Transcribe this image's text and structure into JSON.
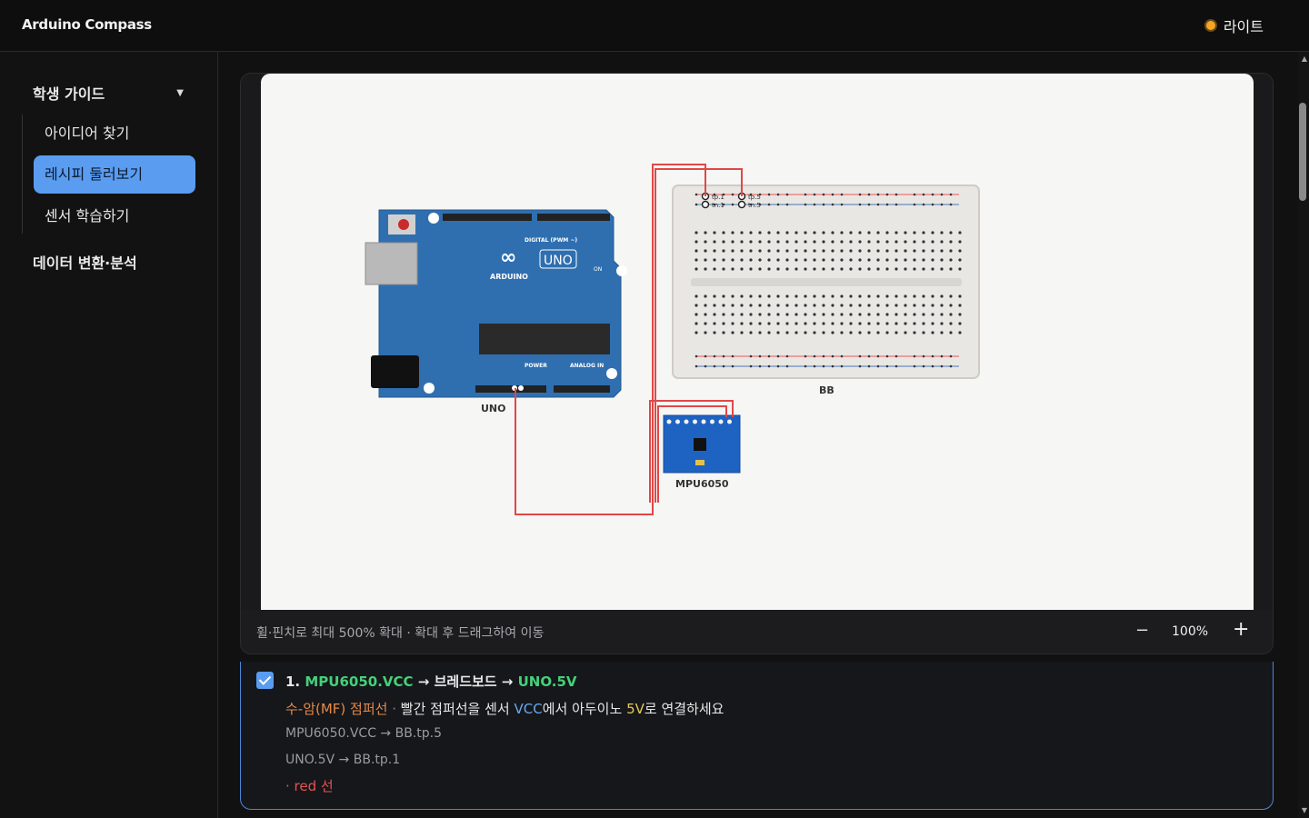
{
  "app": {
    "title": "Arduino Compass",
    "theme_label": "라이트",
    "theme_icon": "sun-icon"
  },
  "sidebar": {
    "group_label": "학생 가이드",
    "items": [
      {
        "label": "아이디어 찾기"
      },
      {
        "label": "레시피 둘러보기",
        "active": true
      },
      {
        "label": "센서 학습하기"
      }
    ],
    "data_label": "데이터 변환·분석"
  },
  "diagram": {
    "uno_label": "UNO",
    "bb_label": "BB",
    "mpu_label": "MPU6050",
    "board_text": "UNO",
    "board_brand": "ARDUINO",
    "digital_label": "DIGITAL (PWM ~)",
    "power_label": "POWER",
    "analog_label": "ANALOG IN",
    "on_label": "ON",
    "pin_labels": {
      "tp1": "tp.1",
      "tn1": "tn.1",
      "tp5": "tp.5",
      "tn5": "tn.5"
    }
  },
  "viewer": {
    "hint": "휠·핀치로 최대 500% 확대 · 확대 후 드래그하여 이동",
    "zoom_minus": "−",
    "zoom_value": "100%",
    "zoom_plus": "+"
  },
  "step": {
    "checked": true,
    "number": "1.",
    "from": "MPU6050.VCC",
    "arrow1": "→ 브레드보드 →",
    "to": "UNO.5V",
    "wire_type": "수-암(MF) 점퍼선",
    "sep": " · ",
    "desc_a": "빨간 점퍼선을 센서 ",
    "desc_vcc": "VCC",
    "desc_b": "에서 아두이노 ",
    "desc_5v": "5V",
    "desc_c": "로 연결하세요",
    "conn1": "MPU6050.VCC → BB.tp.5",
    "conn2": "UNO.5V → BB.tp.1",
    "color_note": "· red 선"
  }
}
